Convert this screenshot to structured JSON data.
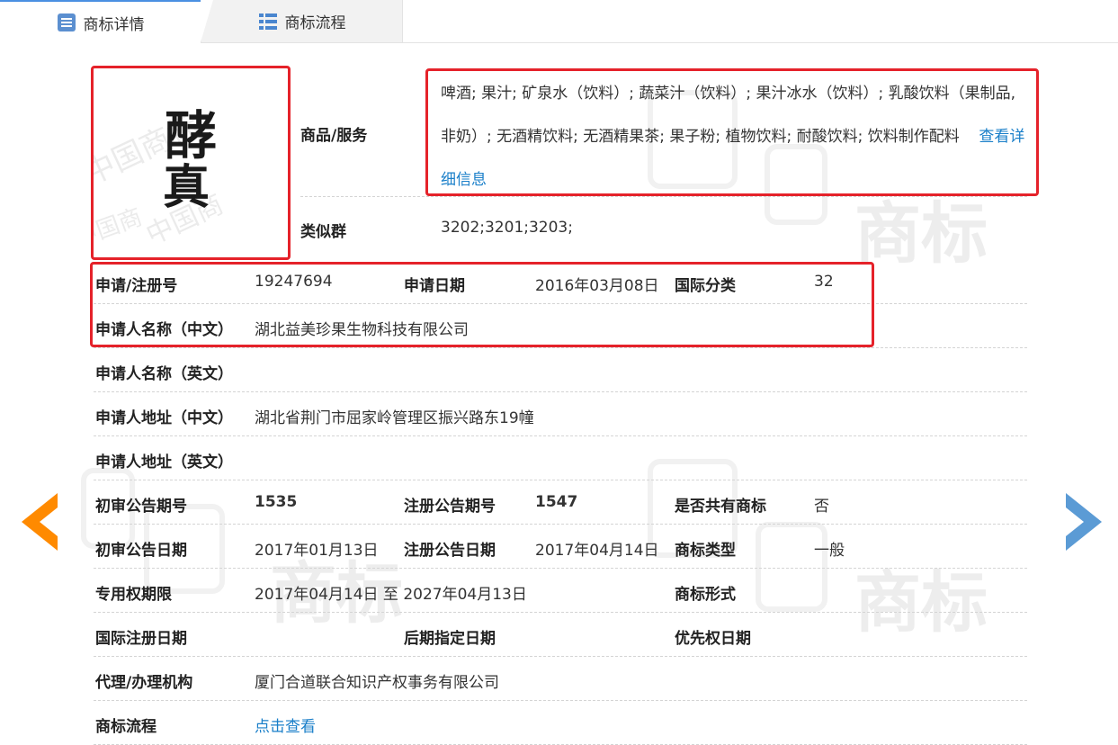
{
  "tabs": [
    {
      "label": "商标详情",
      "active": true
    },
    {
      "label": "商标流程",
      "active": false
    }
  ],
  "watermark": {
    "text_a": "中国",
    "text_b": "商标"
  },
  "colors": {
    "accent": "#1a7fc9",
    "highlight": "#e5222a",
    "arrow_left": "#ff8a00",
    "arrow_right": "#5b9bd5"
  },
  "detail": {
    "goods_label": "商品/服务",
    "goods_text": "啤酒; 果汁; 矿泉水（饮料）; 蔬菜汁（饮料）; 果汁冰水（饮料）; 乳酸饮料（果制品, 非奶）; 无酒精饮料; 无酒精果茶; 果子粉; 植物饮料; 耐酸饮料; 饮料制作配料",
    "goods_more_link": "查看详细信息",
    "similar_label": "类似群",
    "similar_value": "3202;3201;3203;",
    "reg_no_label": "申请/注册号",
    "reg_no_value": "19247694",
    "apply_date_label": "申请日期",
    "apply_date_value": "2016年03月08日",
    "intl_class_label": "国际分类",
    "intl_class_value": "32",
    "applicant_cn_label": "申请人名称（中文）",
    "applicant_cn_value": "湖北益美珍果生物科技有限公司",
    "applicant_en_label": "申请人名称（英文）",
    "applicant_en_value": "",
    "address_cn_label": "申请人地址（中文）",
    "address_cn_value": "湖北省荆门市屈家岭管理区振兴路东19幢",
    "address_en_label": "申请人地址（英文）",
    "address_en_value": "",
    "prelim_no_label": "初审公告期号",
    "prelim_no_value": "1535",
    "reg_notice_no_label": "注册公告期号",
    "reg_notice_no_value": "1547",
    "shared_label": "是否共有商标",
    "shared_value": "否",
    "prelim_date_label": "初审公告日期",
    "prelim_date_value": "2017年01月13日",
    "reg_notice_date_label": "注册公告日期",
    "reg_notice_date_value": "2017年04月14日",
    "mark_type_label": "商标类型",
    "mark_type_value": "一般",
    "exclusive_label": "专用权期限",
    "exclusive_value": "2017年04月14日 至 2027年04月13日",
    "mark_form_label": "商标形式",
    "mark_form_value": "",
    "intl_reg_date_label": "国际注册日期",
    "later_date_label": "后期指定日期",
    "priority_date_label": "优先权日期",
    "agent_label": "代理/办理机构",
    "agent_value": "厦门合道联合知识产权事务有限公司",
    "flow_label": "商标流程",
    "flow_link": "点击查看"
  },
  "logo": {
    "icon": "trademark-image",
    "glyph_top": "酵",
    "glyph_bottom": "真"
  }
}
